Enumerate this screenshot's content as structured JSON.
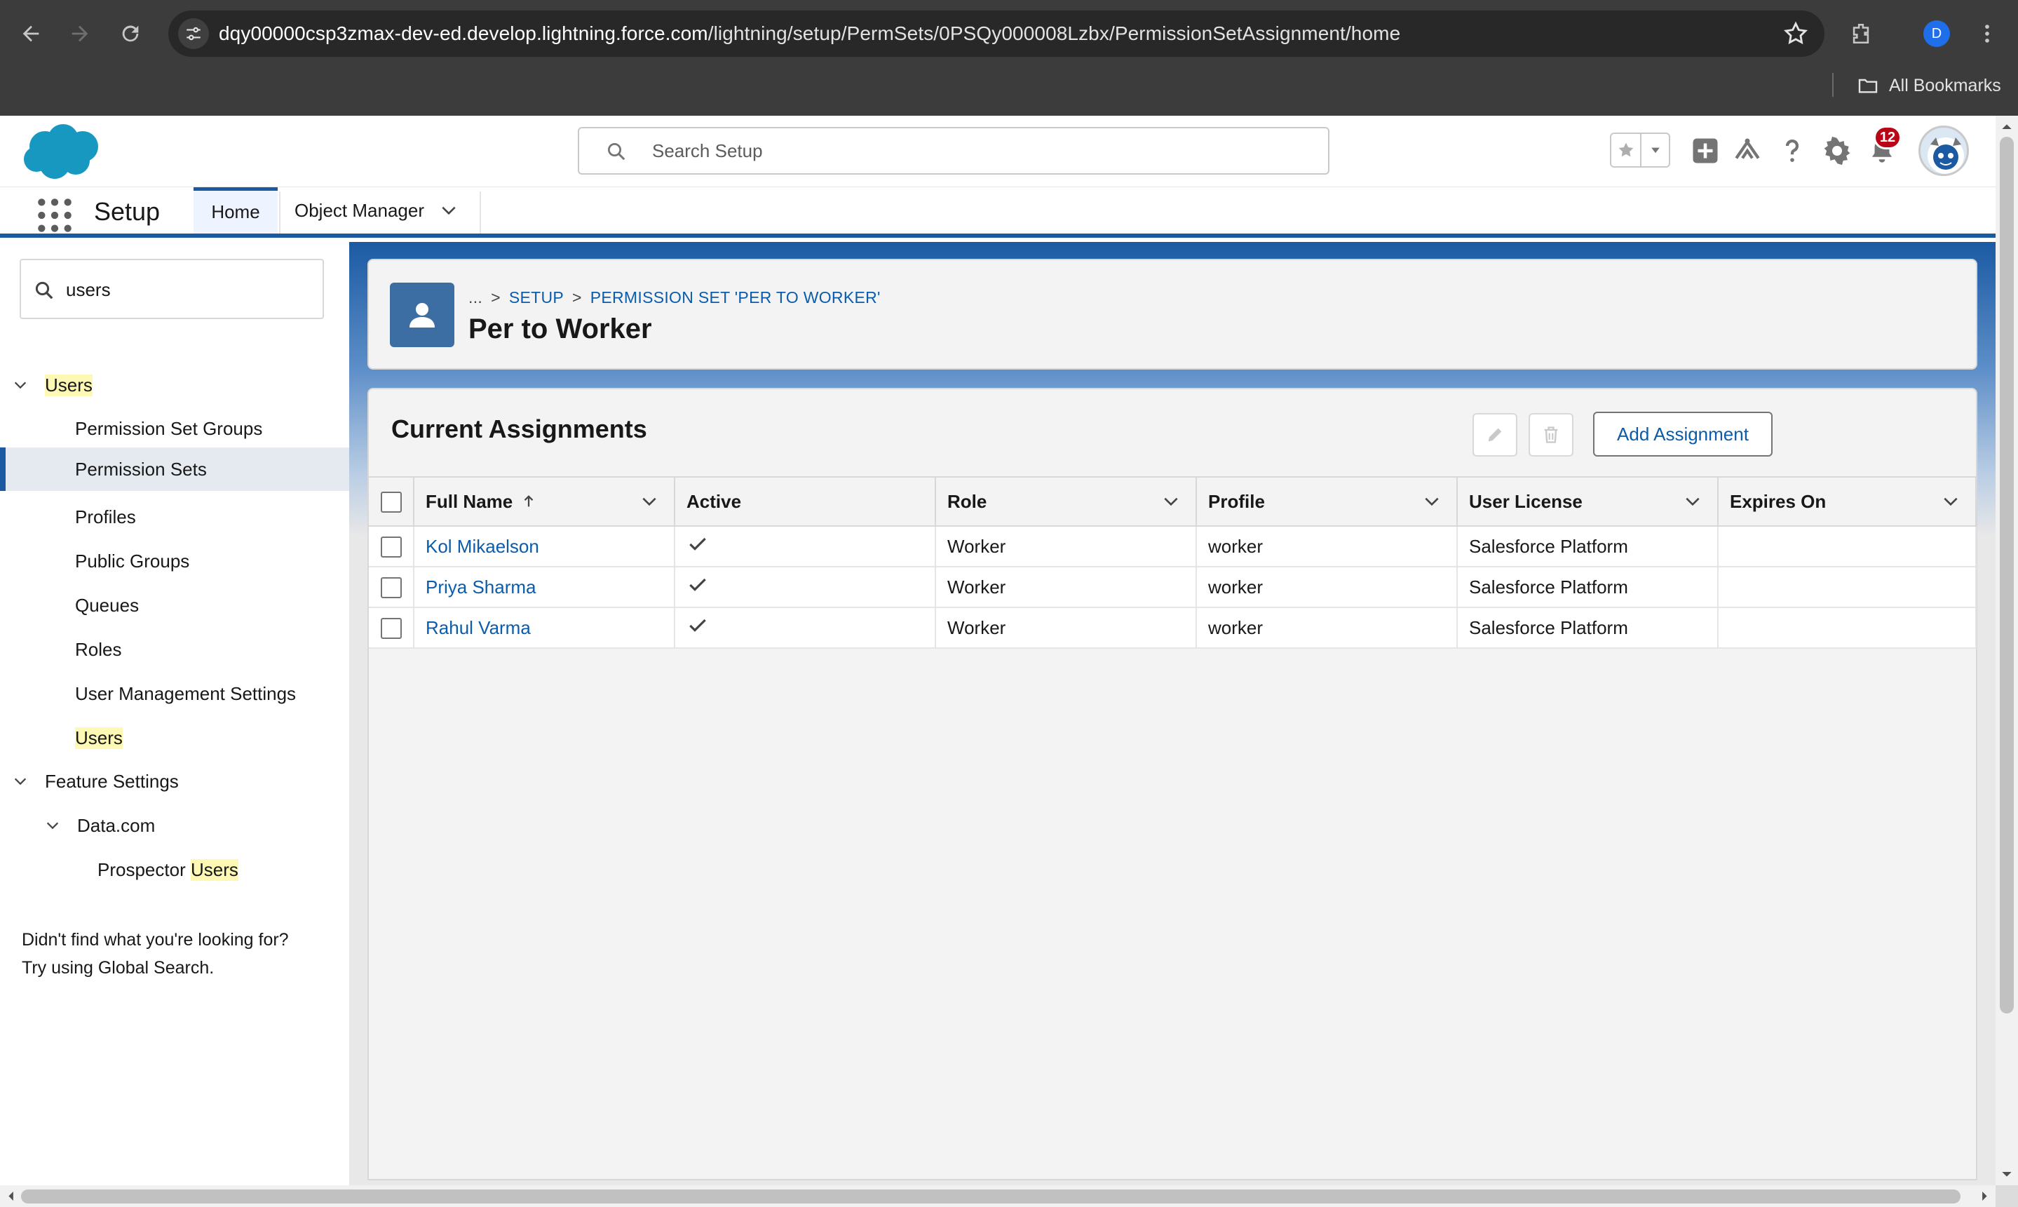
{
  "browser": {
    "url_host": "dqy00000csp3zmax-dev-ed.develop.lightning.force.com",
    "url_path": "/lightning/setup/PermSets/0PSQy000008Lzbx/PermissionSetAssignment/home",
    "profile_initial": "D",
    "bookmarks_label": "All Bookmarks"
  },
  "header": {
    "search_placeholder": "Search Setup",
    "notification_count": "12"
  },
  "navbar": {
    "app_name": "Setup",
    "tabs": [
      {
        "label": "Home",
        "active": true
      },
      {
        "label": "Object Manager",
        "active": false
      }
    ]
  },
  "sidebar": {
    "quickfind_value": "users",
    "items": [
      {
        "label": "Users",
        "level": 0,
        "expandable": true,
        "highlight": true
      },
      {
        "label": "Permission Set Groups",
        "level": 1
      },
      {
        "label": "Permission Sets",
        "level": 1,
        "selected": true
      },
      {
        "label": "Profiles",
        "level": 1
      },
      {
        "label": "Public Groups",
        "level": 1
      },
      {
        "label": "Queues",
        "level": 1
      },
      {
        "label": "Roles",
        "level": 1
      },
      {
        "label": "User Management Settings",
        "level": 1
      },
      {
        "label": "Users",
        "level": 1,
        "highlight": true
      },
      {
        "label": "Feature Settings",
        "level": 0,
        "expandable": true
      },
      {
        "label": "Data.com",
        "level": 1,
        "expandable": true
      },
      {
        "label_prefix": "Prospector ",
        "label_hl": "Users",
        "level": 2
      }
    ],
    "help_line1": "Didn't find what you're looking for?",
    "help_line2": "Try using Global Search."
  },
  "page_header": {
    "breadcrumb": [
      "...",
      ">",
      "SETUP",
      ">",
      "PERMISSION SET 'PER TO WORKER'"
    ],
    "title": "Per to Worker"
  },
  "assignments": {
    "title": "Current Assignments",
    "add_button": "Add Assignment",
    "columns": [
      "Full Name",
      "Active",
      "Role",
      "Profile",
      "User License",
      "Expires On"
    ],
    "rows": [
      {
        "name": "Kol Mikaelson",
        "active": true,
        "role": "Worker",
        "profile": "worker",
        "license": "Salesforce Platform",
        "expires": ""
      },
      {
        "name": "Priya Sharma",
        "active": true,
        "role": "Worker",
        "profile": "worker",
        "license": "Salesforce Platform",
        "expires": ""
      },
      {
        "name": "Rahul Varma",
        "active": true,
        "role": "Worker",
        "profile": "worker",
        "license": "Salesforce Platform",
        "expires": ""
      }
    ]
  },
  "colors": {
    "brand_blue": "#1b5aa3",
    "link": "#0b5cab",
    "highlight": "#fdf8b4",
    "badge": "#ba0517"
  }
}
